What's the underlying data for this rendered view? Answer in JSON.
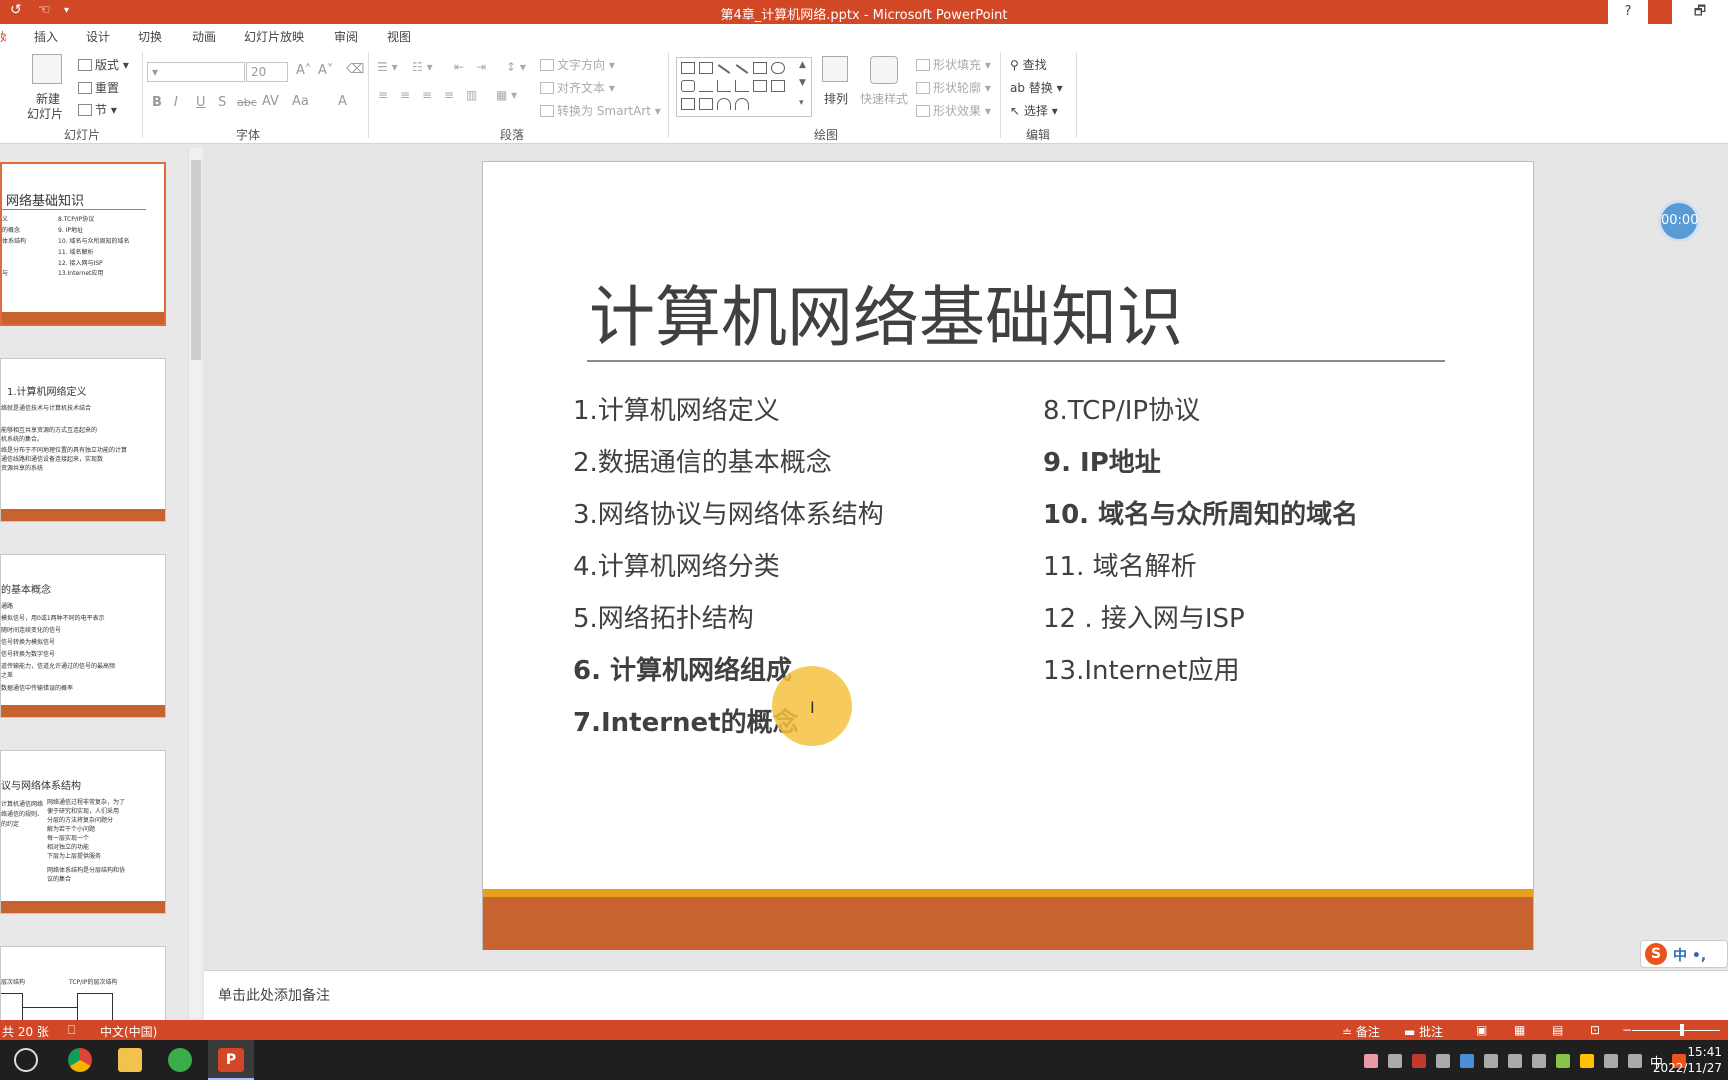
{
  "window": {
    "title": "第4章_计算机网络.pptx - Microsoft PowerPoint",
    "help_label": "?",
    "restore_label": "🗗"
  },
  "tabs": [
    {
      "label": "插入"
    },
    {
      "label": "设计"
    },
    {
      "label": "切换"
    },
    {
      "label": "动画"
    },
    {
      "label": "幻灯片放映"
    },
    {
      "label": "审阅"
    },
    {
      "label": "视图"
    }
  ],
  "ribbon": {
    "slides_group": {
      "label": "幻灯片",
      "new_slide_line1": "新建",
      "new_slide_line2": "幻灯片",
      "layout": "版式",
      "reset": "重置",
      "section": "节"
    },
    "font_group": {
      "label": "字体",
      "font_size": "20"
    },
    "paragraph_group": {
      "label": "段落",
      "text_direction": "文字方向",
      "align_text": "对齐文本",
      "convert_smartart": "转换为 SmartArt"
    },
    "drawing_group": {
      "label": "绘图",
      "arrange": "排列",
      "quick_styles": "快速样式",
      "shape_fill": "形状填充",
      "shape_outline": "形状轮廓",
      "shape_effects": "形状效果"
    },
    "editing_group": {
      "label": "编辑",
      "find": "查找",
      "replace": "替换",
      "select": "选择"
    }
  },
  "thumbnails": [
    {
      "title": "网络基础知识",
      "lines": [
        "义",
        "的概念",
        "体系结构",
        "",
        "",
        "与"
      ],
      "lines_right": [
        "8.TCP/IP协议",
        "9. IP地址",
        "10. 域名与众所周知的域名",
        "11. 域名解析",
        "12. 接入网与ISP",
        "13.Internet应用"
      ]
    },
    {
      "title": "1.计算机网络定义",
      "lines": [
        "络就是通信技术与计算机技术结合",
        "",
        "能够相互共享资源的方式互连起来的",
        "机系统的集合。",
        "络是分布于不同地理位置的具有独立功能的计算",
        "通信线路和通信设备连接起来，实现数",
        "资源共享的系统"
      ]
    },
    {
      "title": "的基本概念",
      "lines": [
        "通路",
        "模拟信号，用0或1两种不同的电平表示",
        "随时间连续变化的信号",
        "信号转换为模拟信号",
        "信号转换为数字信号",
        "道传输能力，信道允许通过的信号的最高频",
        "之差",
        "数据通信中传输错误的概率"
      ]
    },
    {
      "title": "议与网络体系结构",
      "lines": [
        "计算机通信网络",
        "络通信的规则、",
        "的约定"
      ],
      "lines_right": [
        "网络通信过程非常复杂，为了",
        "便于研究和实现，人们采用",
        "分层的方法将复杂问题分",
        "解为若干个小问题",
        "每一层实现一个",
        "相对独立的功能",
        "下层为上层提供服务",
        "网络体系结构是分层结构和协",
        "议的集合"
      ]
    },
    {
      "title": "",
      "lines": [
        "层次结构"
      ],
      "lines_right": [
        "TCP/IP的层次结构"
      ]
    }
  ],
  "slide": {
    "title": "计算机网络基础知识",
    "left_items": [
      {
        "text": "1.计算机网络定义",
        "bold": false
      },
      {
        "text": "2.数据通信的基本概念",
        "bold": false
      },
      {
        "text": "3.网络协议与网络体系结构",
        "bold": false
      },
      {
        "text": "4.计算机网络分类",
        "bold": false
      },
      {
        "text": "5.网络拓扑结构",
        "bold": false
      },
      {
        "text": "6. 计算机网络组成",
        "bold": true
      },
      {
        "text": "7.Internet的概念",
        "bold": true
      }
    ],
    "right_items": [
      {
        "text": "8.TCP/IP协议",
        "bold": false
      },
      {
        "text": "9.  IP地址",
        "bold": true
      },
      {
        "text": "10.  域名与众所周知的域名",
        "bold": true
      },
      {
        "text": "11.   域名解析",
        "bold": false
      },
      {
        "text": "12 . 接入网与ISP",
        "bold": false
      },
      {
        "text": "13.Internet应用",
        "bold": false
      }
    ]
  },
  "timer": "00:00",
  "ime": {
    "logo": "S",
    "text": "中 •,"
  },
  "notes": {
    "placeholder": "单击此处添加备注"
  },
  "status": {
    "slide_count": "共 20 张",
    "language": "中文(中国)",
    "notes_btn": "备注",
    "comments_btn": "批注"
  },
  "taskbar": {
    "tray_lang": "中",
    "time": "15:41",
    "date": "2022/11/27"
  },
  "colors": {
    "accent": "#d24726",
    "slide_bar": "#c8622e",
    "slide_stripe": "#e6a11c"
  }
}
